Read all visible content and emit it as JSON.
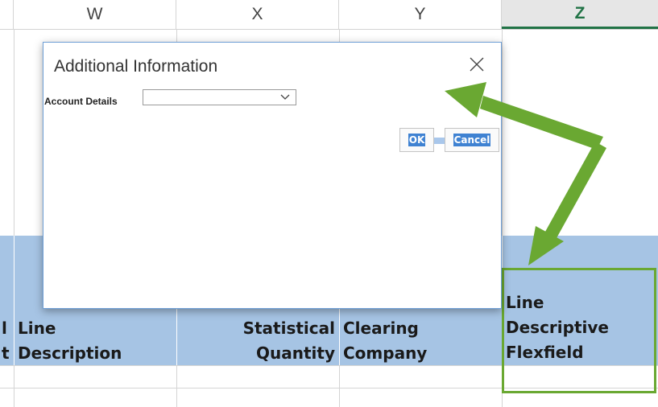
{
  "spreadsheet": {
    "columns": [
      {
        "letter": "W",
        "selected": false
      },
      {
        "letter": "X",
        "selected": false
      },
      {
        "letter": "Y",
        "selected": false
      },
      {
        "letter": "Z",
        "selected": true
      }
    ],
    "header_cells": {
      "v_left_partial": "l\nt",
      "w": "Line\nDescription",
      "x": "Statistical\nQuantity",
      "y": "Clearing\nCompany",
      "z": "Line\nDescriptive\nFlexfield"
    }
  },
  "dialog": {
    "title": "Additional Information",
    "field_label": "Account Details",
    "select_value": "",
    "ok_label": "OK",
    "cancel_label": "Cancel"
  },
  "colors": {
    "header_fill": "#a6c4e4",
    "highlight_green": "#6aa832",
    "selected_column": "#217346"
  },
  "icons": {
    "close": "close-icon",
    "dropdown": "chevron-down-icon"
  }
}
